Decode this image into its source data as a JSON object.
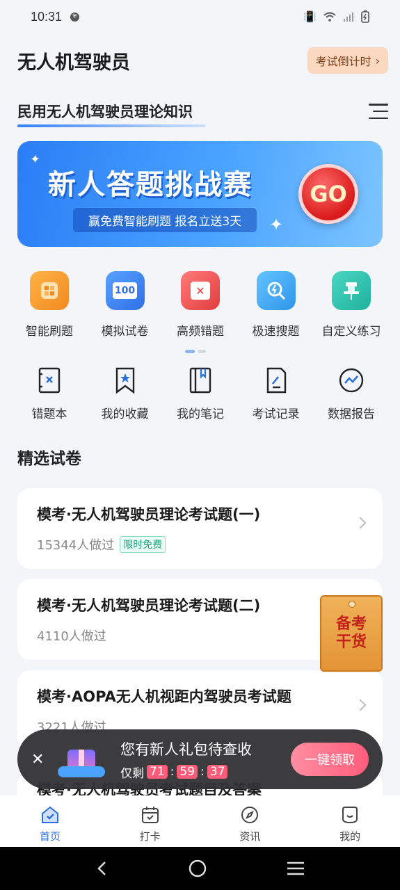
{
  "status": {
    "time": "10:31"
  },
  "header": {
    "title": "无人机驾驶员",
    "countdown_label": "考试倒计时"
  },
  "subject": {
    "name": "民用无人机驾驶员理论知识"
  },
  "banner": {
    "headline": "新人答题挑战赛",
    "sub": "赢免费智能刷题  报名立送3天",
    "go": "GO"
  },
  "features": [
    {
      "label": "智能刷题",
      "icon": "smart-practice-icon",
      "color": "#f7a032"
    },
    {
      "label": "模拟试卷",
      "icon": "mock-exam-icon",
      "color": "#3d8bff",
      "text": "100"
    },
    {
      "label": "高频错题",
      "icon": "frequent-mistakes-icon",
      "color": "#f25757"
    },
    {
      "label": "极速搜题",
      "icon": "quick-search-icon",
      "color": "#3aa8f5"
    },
    {
      "label": "自定义练习",
      "icon": "custom-practice-icon",
      "color": "#31c6b0"
    }
  ],
  "tools": [
    {
      "label": "错题本",
      "icon": "mistake-book-icon"
    },
    {
      "label": "我的收藏",
      "icon": "favorites-icon"
    },
    {
      "label": "我的笔记",
      "icon": "notes-icon"
    },
    {
      "label": "考试记录",
      "icon": "exam-record-icon"
    },
    {
      "label": "数据报告",
      "icon": "data-report-icon"
    }
  ],
  "section": {
    "title": "精选试卷"
  },
  "papers": [
    {
      "title": "模考·无人机驾驶员理论考试题(一)",
      "count": "15344人做过",
      "tag": "限时免费"
    },
    {
      "title": "模考·无人机驾驶员理论考试题(二)",
      "count": "4110人做过"
    },
    {
      "title": "模考·AOPA无人机视距内驾驶员考试题",
      "count": "3221人做过"
    },
    {
      "title": "模考·无人机驾驶员考试题目及答案"
    }
  ],
  "envelope": {
    "line1": "备考",
    "line2": "干货"
  },
  "toast": {
    "title": "您有新人礼包待查收",
    "prefix": "仅剩",
    "h": "71",
    "m": "59",
    "s": "37",
    "claim": "一键领取"
  },
  "tabs": [
    {
      "label": "首页",
      "icon": "home-icon",
      "active": true
    },
    {
      "label": "打卡",
      "icon": "calendar-icon"
    },
    {
      "label": "资讯",
      "icon": "compass-icon"
    },
    {
      "label": "我的",
      "icon": "profile-icon"
    }
  ]
}
